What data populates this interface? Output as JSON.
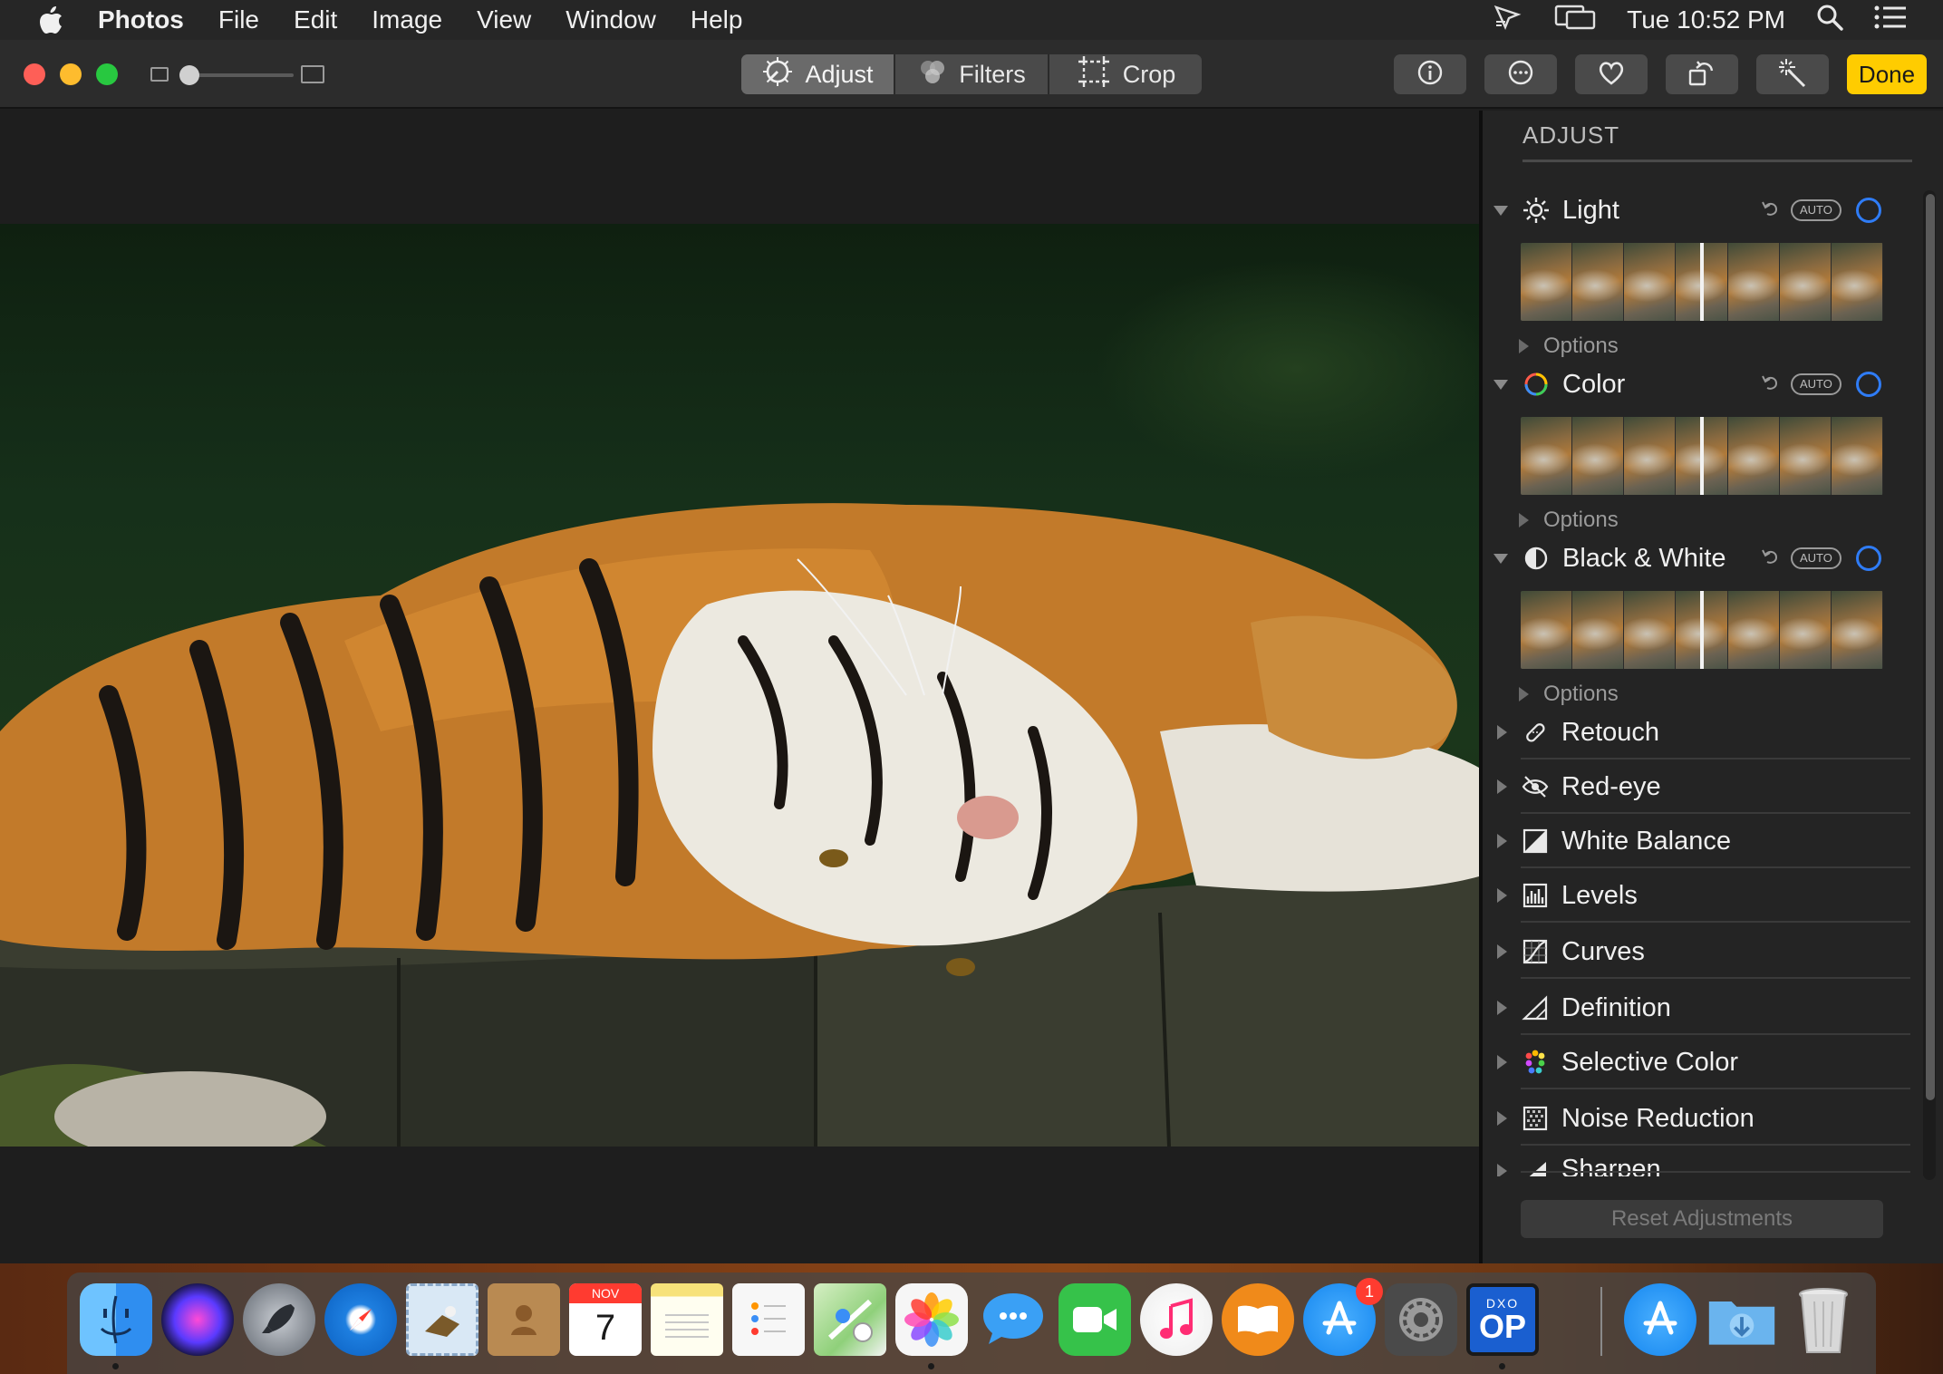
{
  "menubar": {
    "app_name": "Photos",
    "items": [
      "File",
      "Edit",
      "Image",
      "View",
      "Window",
      "Help"
    ],
    "clock": "Tue 10:52 PM"
  },
  "toolbar": {
    "tabs": [
      {
        "label": "Adjust",
        "icon": "adjust-dial-icon",
        "active": true
      },
      {
        "label": "Filters",
        "icon": "filters-circles-icon",
        "active": false
      },
      {
        "label": "Crop",
        "icon": "crop-icon",
        "active": false
      }
    ],
    "buttons": [
      "info-icon",
      "more-icon",
      "heart-icon",
      "rotate-icon",
      "enhance-wand-icon"
    ],
    "done_label": "Done",
    "zoom_level": 0.0
  },
  "photo": {
    "subject_icon": "tiger-photo"
  },
  "sidebar": {
    "title": "ADJUST",
    "expanded_sections": [
      {
        "label": "Light",
        "icon": "sun-icon",
        "auto": "AUTO",
        "options": "Options",
        "slider_value": 0.5
      },
      {
        "label": "Color",
        "icon": "color-ring-icon",
        "auto": "AUTO",
        "options": "Options",
        "slider_value": 0.5
      },
      {
        "label": "Black & White",
        "icon": "half-circle-icon",
        "auto": "AUTO",
        "options": "Options",
        "slider_value": 0.5
      }
    ],
    "tools": [
      {
        "label": "Retouch",
        "icon": "bandage-icon"
      },
      {
        "label": "Red-eye",
        "icon": "eye-slash-icon"
      },
      {
        "label": "White Balance",
        "icon": "white-balance-icon"
      },
      {
        "label": "Levels",
        "icon": "levels-histogram-icon"
      },
      {
        "label": "Curves",
        "icon": "curves-icon"
      },
      {
        "label": "Definition",
        "icon": "triangle-icon"
      },
      {
        "label": "Selective Color",
        "icon": "color-dots-icon"
      },
      {
        "label": "Noise Reduction",
        "icon": "noise-grid-icon"
      },
      {
        "label": "Sharpen",
        "icon": "sharpen-triangle-icon"
      }
    ],
    "reset_label": "Reset Adjustments"
  },
  "dock": {
    "apps": [
      {
        "name": "Finder",
        "icon": "finder-icon",
        "color": "#2f8ef0",
        "running": true
      },
      {
        "name": "Siri",
        "icon": "siri-icon",
        "color": "#3a2a6a",
        "running": false
      },
      {
        "name": "Launchpad",
        "icon": "rocket-icon",
        "color": "#8a8f96",
        "running": false
      },
      {
        "name": "Safari",
        "icon": "compass-icon",
        "color": "#1e7fe0",
        "running": false
      },
      {
        "name": "Mail",
        "icon": "mail-stamp-icon",
        "color": "#4aa3e6",
        "running": false
      },
      {
        "name": "Contacts",
        "icon": "contacts-book-icon",
        "color": "#b98a52",
        "running": false
      },
      {
        "name": "Calendar",
        "icon": "calendar-icon",
        "color": "#ffffff",
        "running": false,
        "month": "NOV",
        "day": "7"
      },
      {
        "name": "Notes",
        "icon": "notes-icon",
        "color": "#f7e27a",
        "running": false
      },
      {
        "name": "Reminders",
        "icon": "reminders-icon",
        "color": "#f4f4f4",
        "running": false
      },
      {
        "name": "Maps",
        "icon": "maps-icon",
        "color": "#8fd07a",
        "running": false
      },
      {
        "name": "Photos",
        "icon": "photos-flower-icon",
        "color": "#f4f4f4",
        "running": true
      },
      {
        "name": "Messages",
        "icon": "messages-bubble-icon",
        "color": "#3aa0f5",
        "running": false
      },
      {
        "name": "FaceTime",
        "icon": "facetime-camera-icon",
        "color": "#36c24a",
        "running": false
      },
      {
        "name": "iTunes",
        "icon": "music-note-icon",
        "color": "#f2f2f2",
        "running": false
      },
      {
        "name": "iBooks",
        "icon": "book-icon",
        "color": "#f08a1a",
        "running": false
      },
      {
        "name": "App Store",
        "icon": "app-store-icon",
        "color": "#1f8ef2",
        "running": false,
        "badge": "1"
      },
      {
        "name": "System Preferences",
        "icon": "gear-icon",
        "color": "#7a7a7a",
        "running": false
      },
      {
        "name": "DxO OpticsPro",
        "icon": "dxo-op-icon",
        "color": "#1a5fd0",
        "running": true,
        "label_top": "DXO",
        "label_bottom": "OP"
      },
      {
        "name": "App Store Updates",
        "icon": "app-store-download-icon",
        "color": "#1f8ef2",
        "running": false
      },
      {
        "name": "Downloads",
        "icon": "downloads-folder-icon",
        "color": "#6ab4ee",
        "running": false
      },
      {
        "name": "Trash",
        "icon": "trash-icon",
        "color": "#d8d8d8",
        "running": false
      }
    ]
  }
}
